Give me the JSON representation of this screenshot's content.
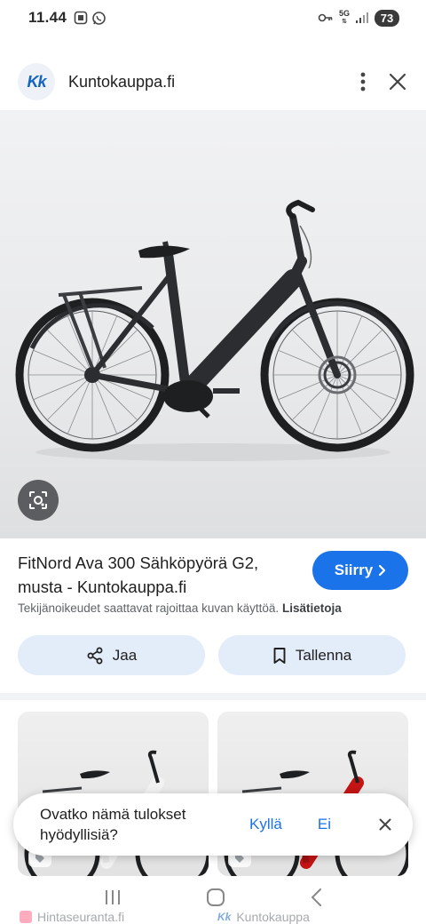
{
  "status_bar": {
    "time": "11.44",
    "network": "5G",
    "battery": "73"
  },
  "site": {
    "logo_text": "Kk",
    "name": "Kuntokauppa.fi"
  },
  "result": {
    "title": "FitNord Ava 300 Sähköpyörä G2, musta - Kuntokauppa.fi",
    "visit_label": "Siirry",
    "copyright_text": "Tekijänoikeudet saattavat rajoittaa kuvan käyttöä.",
    "more_info_label": "Lisätietoja"
  },
  "actions": {
    "share_label": "Jaa",
    "save_label": "Tallenna"
  },
  "related": [
    {
      "source": "Hintaseuranta.fi",
      "bike_color": "#f2f2f2"
    },
    {
      "source": "Kuntokauppa",
      "logo": "Kk",
      "bike_color": "#c41414"
    }
  ],
  "feedback": {
    "question": "Ovatko nämä tulokset hyödyllisiä?",
    "yes_label": "Kyllä",
    "no_label": "Ei"
  },
  "colors": {
    "accent": "#1a73e8",
    "chip_bg": "#e3ecf9",
    "bike_frame": "#2b2d30"
  },
  "icons": [
    "qr-icon",
    "whatsapp-icon",
    "key-icon",
    "signal-icon",
    "more-vert-icon",
    "close-icon",
    "lens-icon",
    "chevron-right-icon",
    "share-icon",
    "bookmark-icon",
    "tag-icon",
    "recents-icon",
    "home-icon",
    "back-icon"
  ]
}
